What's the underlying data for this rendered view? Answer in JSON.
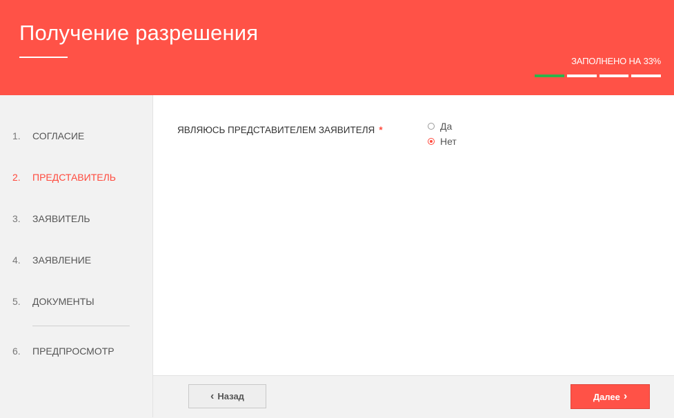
{
  "header": {
    "title": "Получение разрешения",
    "progress_label": "ЗАПОЛНЕНО НА 33%",
    "progress_fraction": 0.25
  },
  "sidebar": {
    "items": [
      {
        "num": "1.",
        "label": "СОГЛАСИЕ"
      },
      {
        "num": "2.",
        "label": "ПРЕДСТАВИТЕЛЬ",
        "active": true
      },
      {
        "num": "3.",
        "label": "ЗАЯВИТЕЛЬ"
      },
      {
        "num": "4.",
        "label": "ЗАЯВЛЕНИЕ"
      },
      {
        "num": "5.",
        "label": "ДОКУМЕНТЫ"
      },
      {
        "num": "6.",
        "label": "ПРЕДПРОСМОТР"
      }
    ]
  },
  "form": {
    "question_label": "ЯВЛЯЮСЬ ПРЕДСТАВИТЕЛЕМ ЗАЯВИТЕЛЯ",
    "required_mark": "*",
    "options": [
      {
        "label": "Да",
        "checked": false
      },
      {
        "label": "Нет",
        "checked": true
      }
    ]
  },
  "footer": {
    "back_label": "Назад",
    "next_label": "Далее"
  },
  "icons": {
    "back": "chevron-left-icon",
    "next": "chevron-right-icon",
    "back_glyph": "‹",
    "next_glyph": "›"
  },
  "colors": {
    "accent": "#ff5247",
    "progress_done": "#2db34a"
  }
}
